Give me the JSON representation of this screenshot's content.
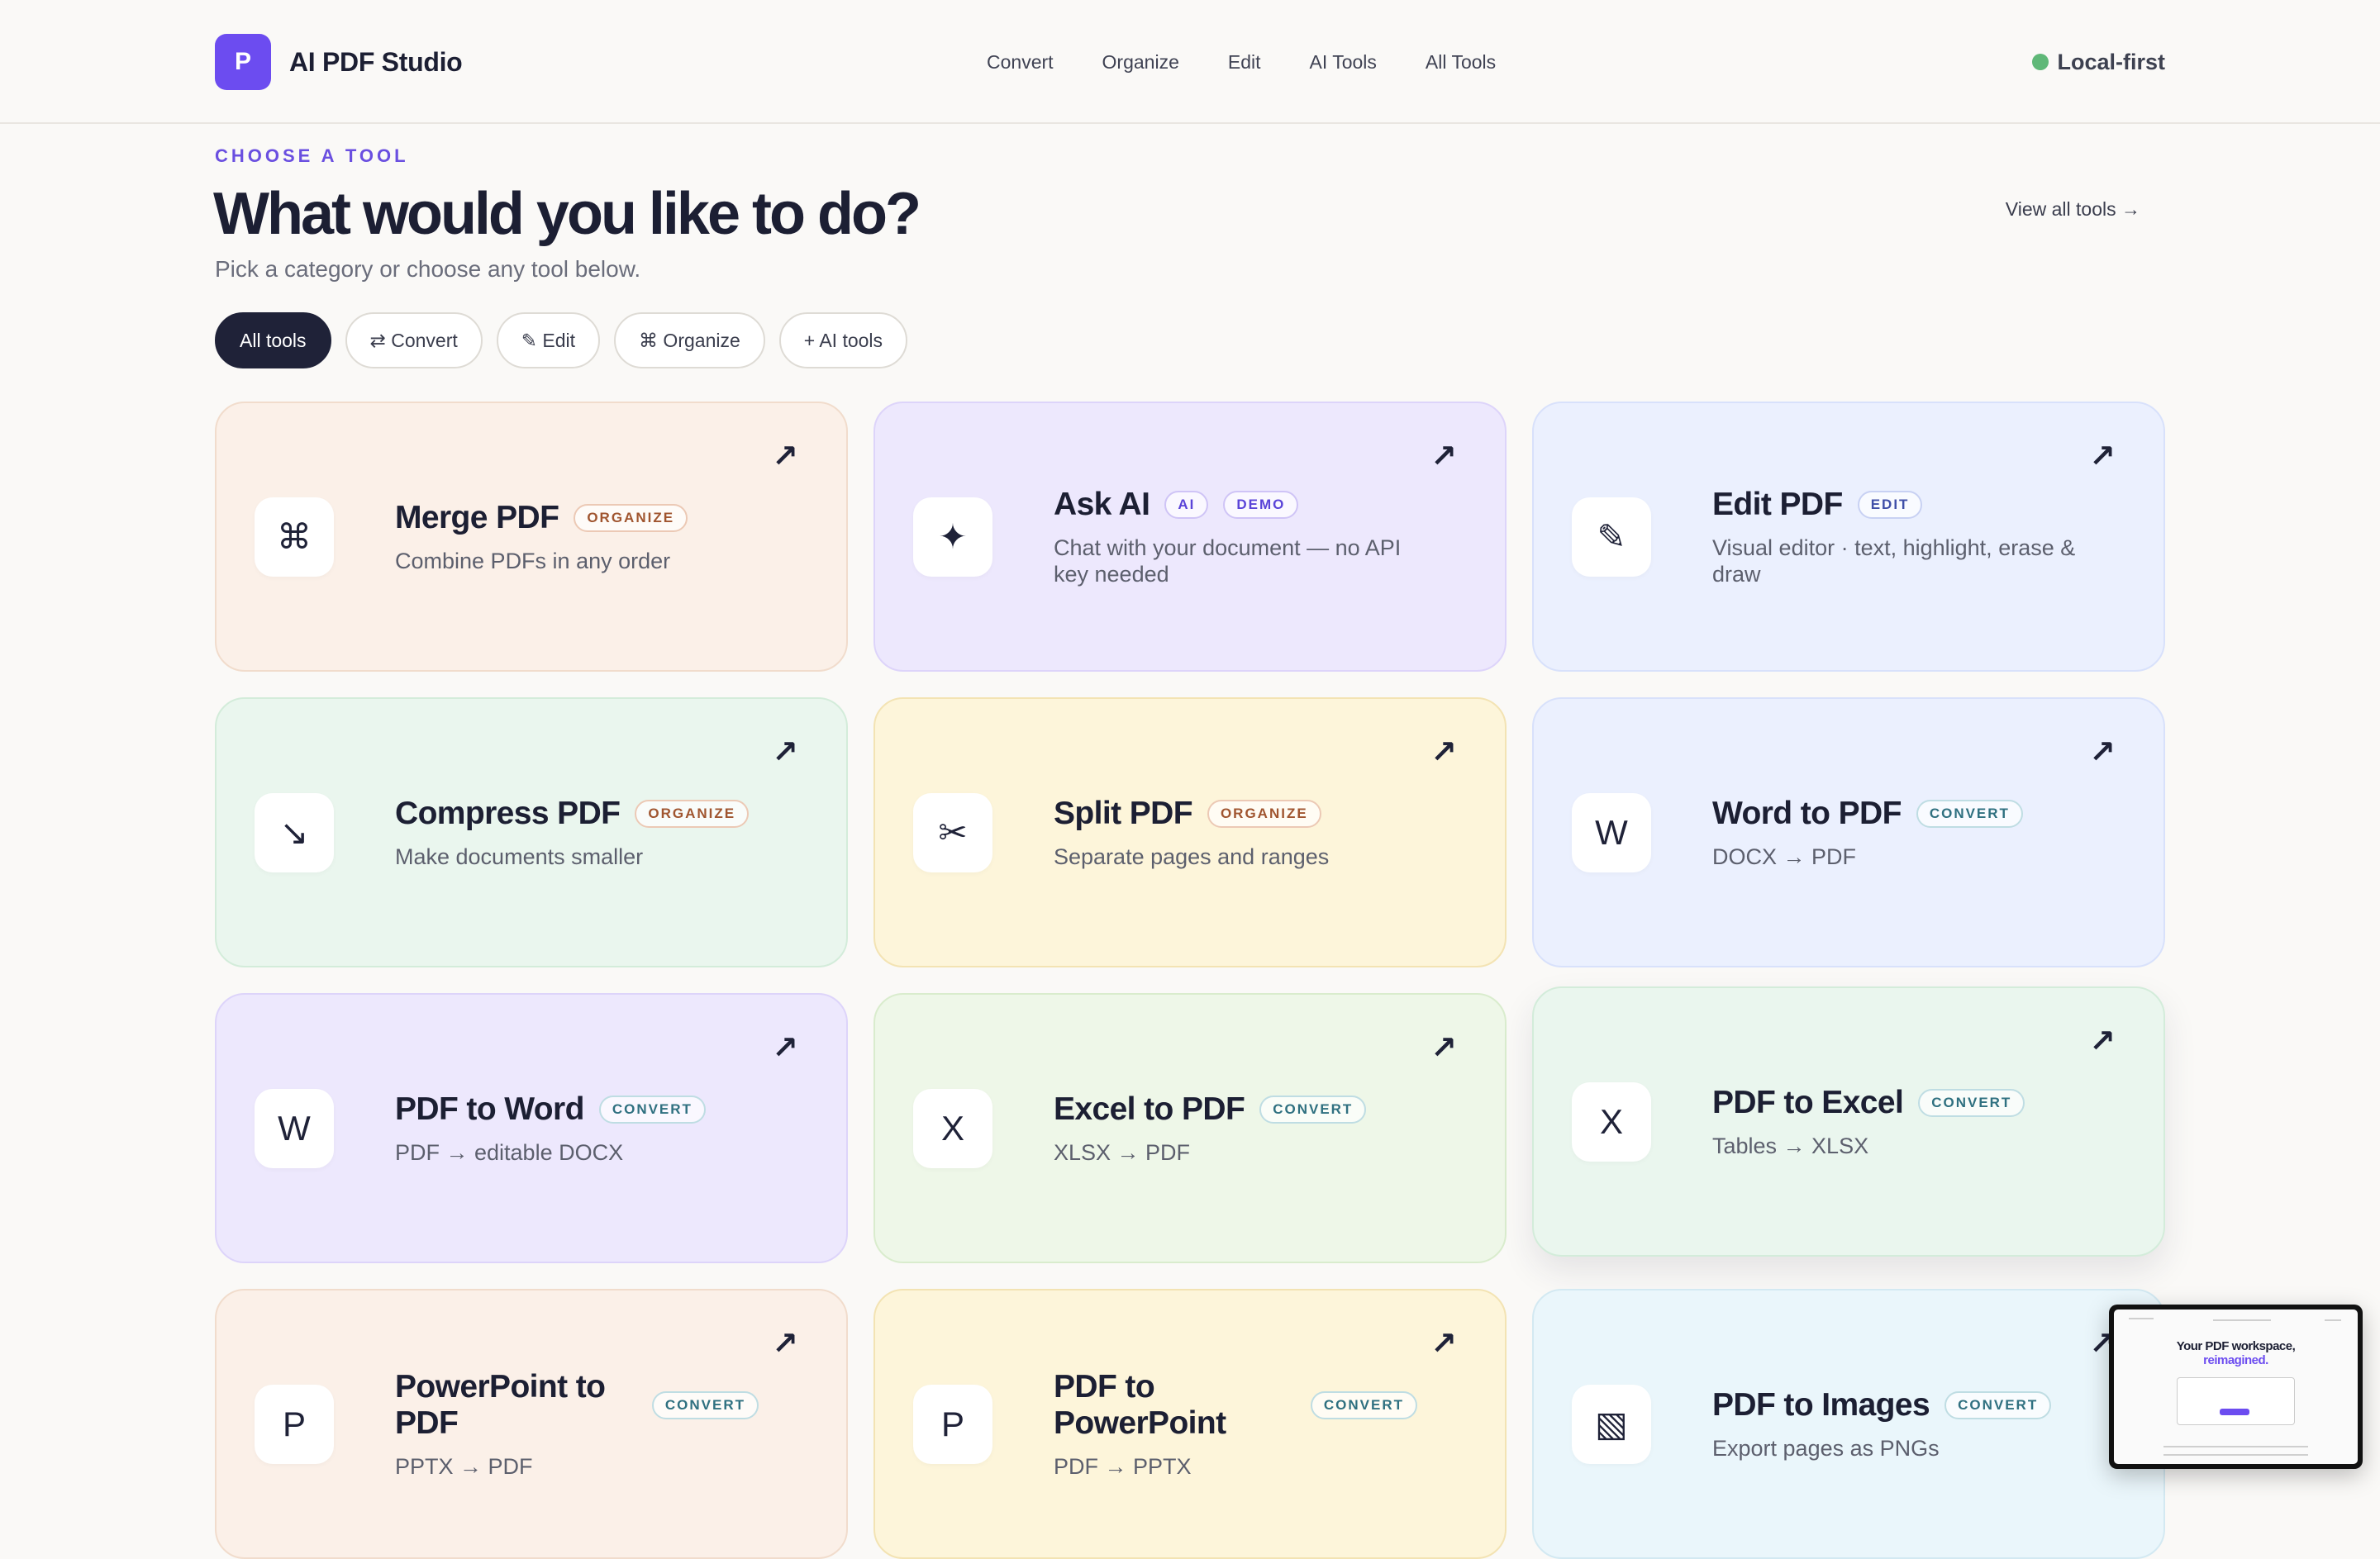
{
  "brand": {
    "logo_letter": "P",
    "name": "AI PDF Studio"
  },
  "nav": {
    "items": [
      "Convert",
      "Organize",
      "Edit",
      "AI Tools",
      "All Tools"
    ]
  },
  "status": {
    "label": "Local-first",
    "color": "#5fb878"
  },
  "intro": {
    "eyebrow": "CHOOSE A TOOL",
    "headline": "What would you like to do?",
    "subline": "Pick a category or choose any tool below.",
    "view_all": "View all tools →"
  },
  "filters": [
    {
      "label": "All tools",
      "active": true
    },
    {
      "label": "⇄ Convert",
      "active": false
    },
    {
      "label": "✎ Edit",
      "active": false
    },
    {
      "label": "⌘ Organize",
      "active": false
    },
    {
      "label": "+ AI tools",
      "active": false
    }
  ],
  "tools": [
    {
      "icon": "⌘",
      "icon_name": "merge-icon",
      "title": "Merge PDF",
      "tags": [
        "ORGANIZE"
      ],
      "desc": "Combine PDFs in any order",
      "color": "#fbf0e8"
    },
    {
      "icon": "✦",
      "icon_name": "sparkle-icon",
      "title": "Ask AI",
      "tags": [
        "AI",
        "DEMO"
      ],
      "desc": "Chat with your document — no API key needed",
      "color": "#ede8fd"
    },
    {
      "icon": "✎",
      "icon_name": "pencil-icon",
      "title": "Edit PDF",
      "tags": [
        "EDIT"
      ],
      "desc": "Visual editor · text, highlight, erase & draw",
      "color": "#ebf0fe"
    },
    {
      "icon": "↘",
      "icon_name": "compress-icon",
      "title": "Compress PDF",
      "tags": [
        "ORGANIZE"
      ],
      "desc": "Make documents smaller",
      "color": "#eaf6ee"
    },
    {
      "icon": "✂",
      "icon_name": "scissors-icon",
      "title": "Split PDF",
      "tags": [
        "ORGANIZE"
      ],
      "desc": "Separate pages and ranges",
      "color": "#fdf5da"
    },
    {
      "icon": "W",
      "icon_name": "word-icon",
      "title": "Word to PDF",
      "tags": [
        "CONVERT"
      ],
      "desc": "DOCX → PDF",
      "color": "#ebf0fe"
    },
    {
      "icon": "W",
      "icon_name": "word-icon",
      "title": "PDF to Word",
      "tags": [
        "CONVERT"
      ],
      "desc": "PDF → editable DOCX",
      "color": "#ede8fd"
    },
    {
      "icon": "X",
      "icon_name": "excel-icon",
      "title": "Excel to PDF",
      "tags": [
        "CONVERT"
      ],
      "desc": "XLSX → PDF",
      "color": "#eef7e8"
    },
    {
      "icon": "X",
      "icon_name": "excel-icon",
      "title": "PDF to Excel",
      "tags": [
        "CONVERT"
      ],
      "desc": "Tables → XLSX",
      "color": "#eaf6ee"
    },
    {
      "icon": "P",
      "icon_name": "powerpoint-icon",
      "title": "PowerPoint to PDF",
      "tags": [
        "CONVERT"
      ],
      "desc": "PPTX → PDF",
      "color": "#fbf0e8"
    },
    {
      "icon": "P",
      "icon_name": "powerpoint-icon",
      "title": "PDF to PowerPoint",
      "tags": [
        "CONVERT"
      ],
      "desc": "PDF → PPTX",
      "color": "#fdf5da"
    },
    {
      "icon": "▧",
      "icon_name": "image-icon",
      "title": "PDF to Images",
      "tags": [
        "CONVERT"
      ],
      "desc": "Export pages as PNGs",
      "color": "#eaf6fb"
    }
  ],
  "card_arrow": "↗",
  "preview": {
    "title": "Your PDF workspace,",
    "title_accent": "reimagined."
  }
}
